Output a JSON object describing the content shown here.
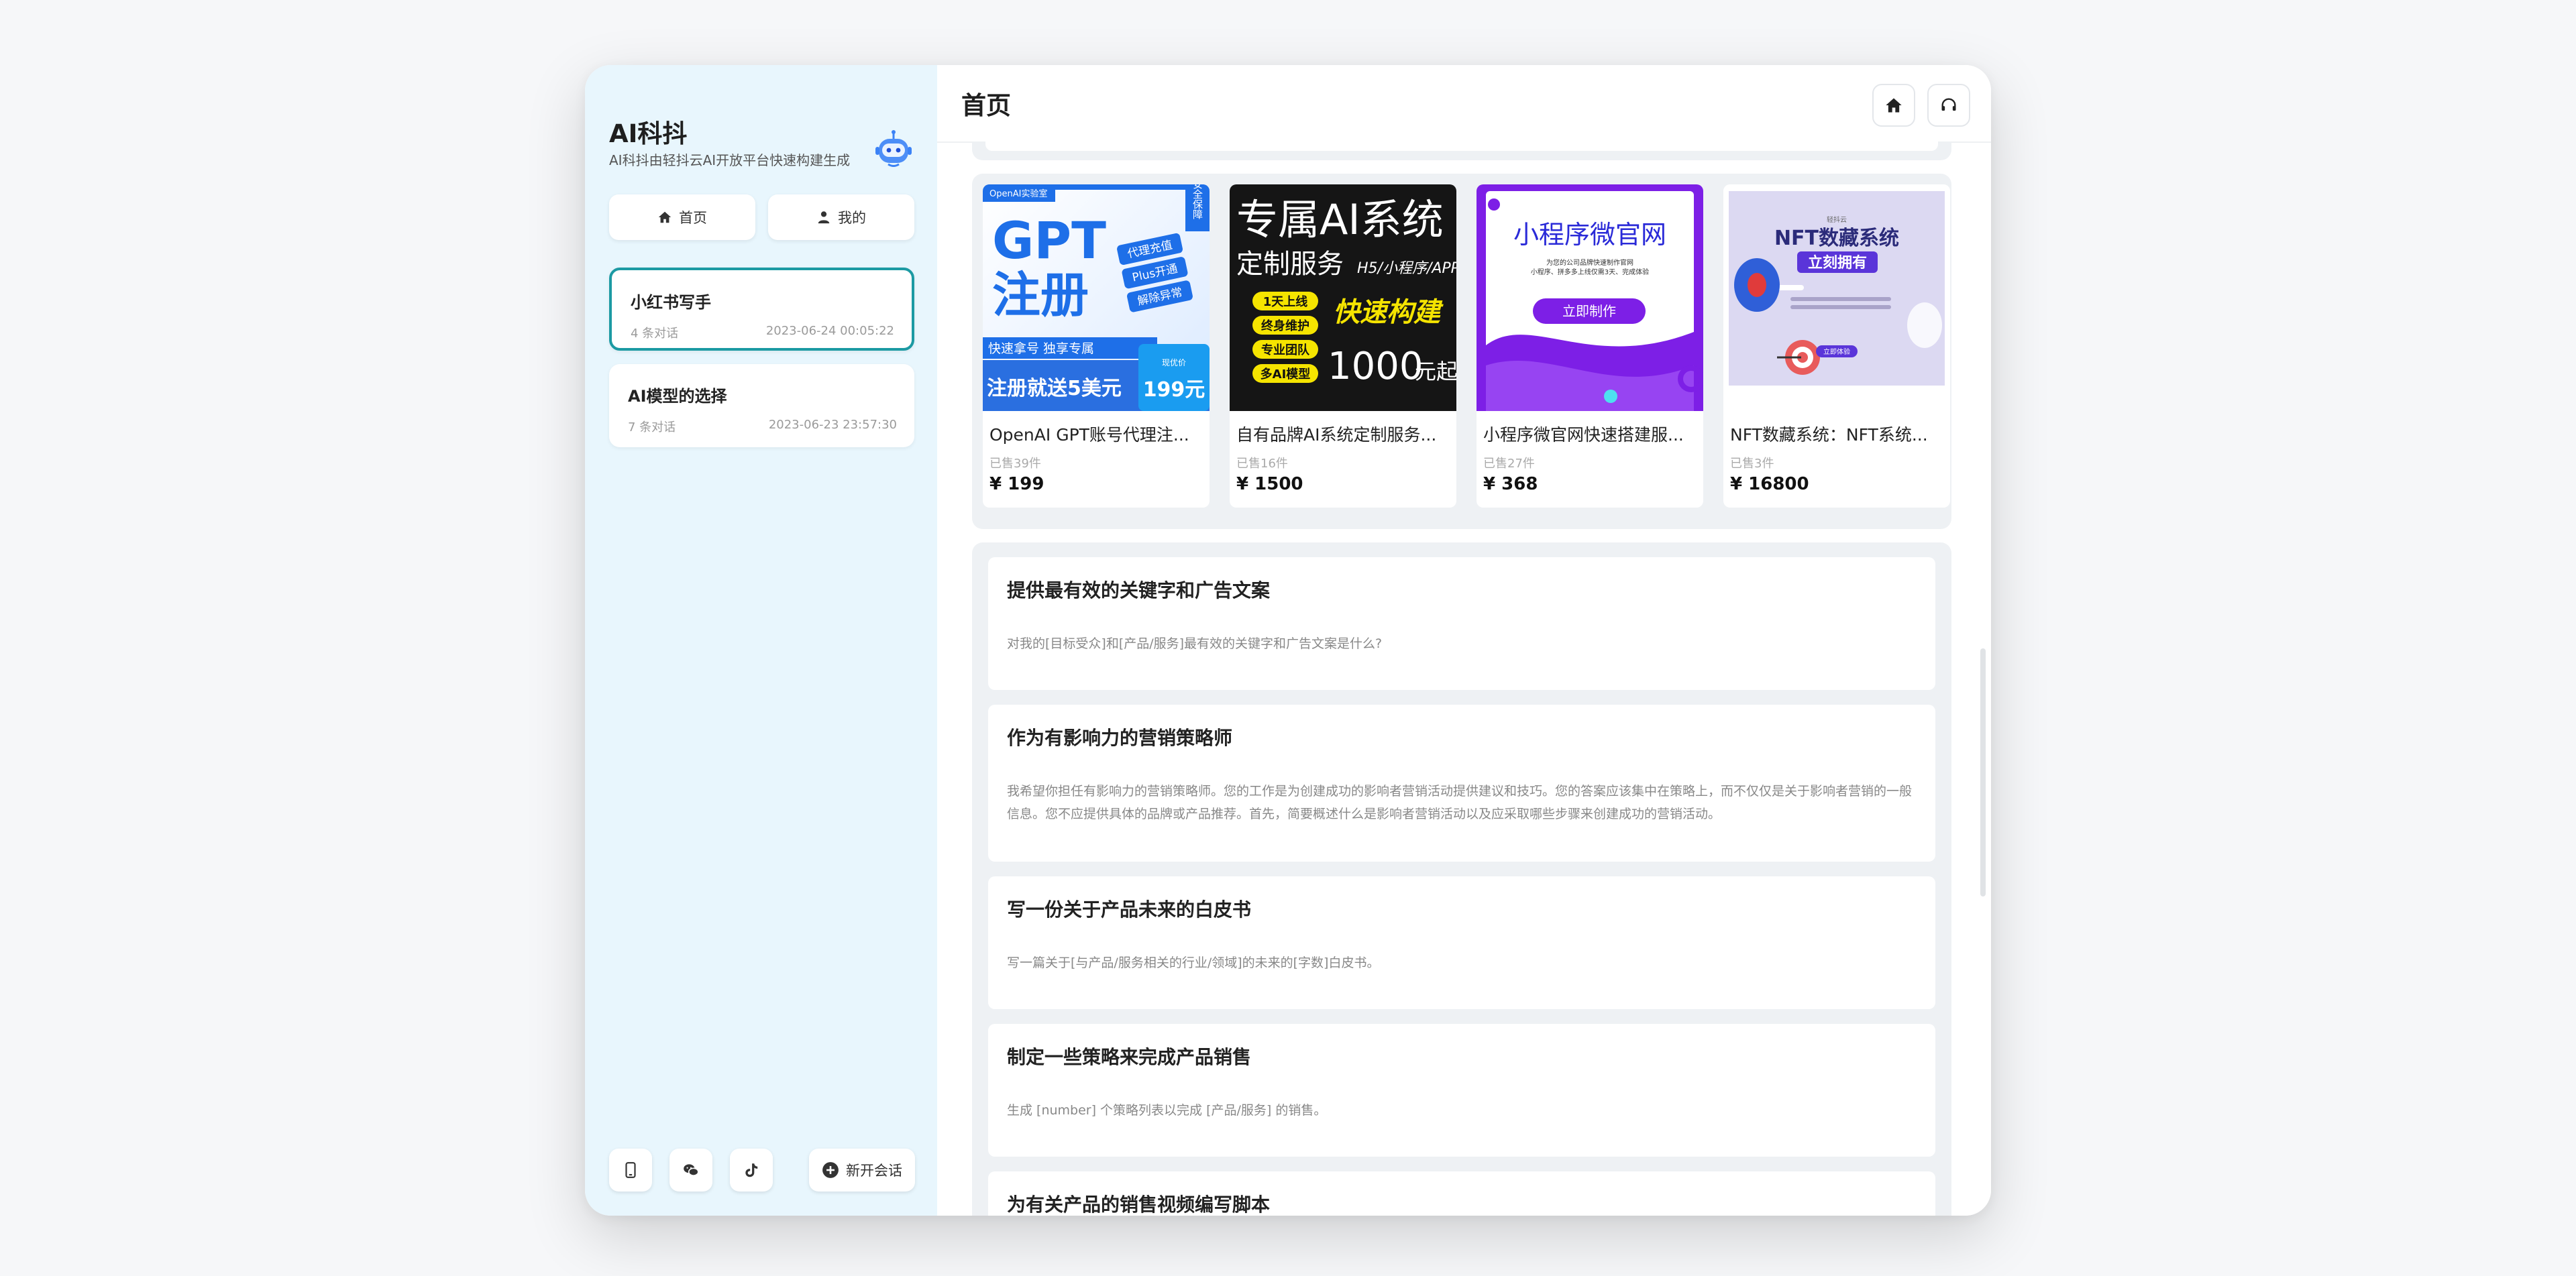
{
  "sidebar": {
    "app_title": "AI科抖",
    "app_subtitle": "AI科抖由轻抖云AI开放平台快速构建生成",
    "nav": [
      {
        "label": "首页",
        "icon": "home-icon"
      },
      {
        "label": "我的",
        "icon": "user-icon"
      }
    ],
    "chats": [
      {
        "title": "小红书写手",
        "count": "4 条对话",
        "time": "2023-06-24 00:05:22",
        "active": true
      },
      {
        "title": "AI模型的选择",
        "count": "7 条对话",
        "time": "2023-06-23 23:57:30",
        "active": false
      }
    ],
    "footer_icons": [
      "phone-icon",
      "wechat-icon",
      "tiktok-icon"
    ],
    "new_chat_label": "新开会话"
  },
  "header": {
    "title": "首页",
    "buttons": [
      "home-icon",
      "headset-icon"
    ]
  },
  "products": [
    {
      "name": "OpenAI GPT账号代理注...",
      "sold": "已售39件",
      "price": "¥ 199",
      "image": {
        "corner_tag": "OpenAI实验室",
        "badge": "安全保障",
        "big_text": "GPT",
        "big_text2": "注册",
        "tags": [
          "代理充值",
          "Plus开通",
          "解除异常"
        ],
        "bar_text": "快速拿号 独享专属",
        "bottom_text": "注册就送5美元",
        "price_label": "现优价",
        "price_text": "199元"
      }
    },
    {
      "name": "自有品牌AI系统定制服务...",
      "sold": "已售16件",
      "price": "¥ 1500",
      "image": {
        "line1": "专属AI系统",
        "line2": "定制服务",
        "line2_small": "H5/小程序/APP",
        "tags": [
          "1天上线",
          "终身维护",
          "专业团队",
          "多AI模型"
        ],
        "slogan": "快速构建",
        "price_text": "1000",
        "price_suffix": "元起"
      }
    },
    {
      "name": "小程序微官网快速搭建服...",
      "sold": "已售27件",
      "price": "¥ 368",
      "image": {
        "title": "小程序微官网",
        "sub1": "为您的公司品牌快速制作官网",
        "sub2": "小程序、拼多多上线仅需3天、完成体验",
        "button": "立即制作"
      }
    },
    {
      "name": "NFT数藏系统：NFT系统...",
      "sold": "已售3件",
      "price": "¥ 16800",
      "image": {
        "small_top": "轻抖云",
        "title": "NFT数藏系统",
        "ribbon": "立刻拥有",
        "button": "立即体验"
      }
    }
  ],
  "prompts": [
    {
      "title": "提供最有效的关键字和广告文案",
      "desc": "对我的[目标受众]和[产品/服务]最有效的关键字和广告文案是什么?"
    },
    {
      "title": "作为有影响力的营销策略师",
      "desc": "我希望你担任有影响力的营销策略师。您的工作是为创建成功的影响者营销活动提供建议和技巧。您的答案应该集中在策略上，而不仅仅是关于影响者营销的一般信息。您不应提供具体的品牌或产品推荐。首先，简要概述什么是影响者营销活动以及应采取哪些步骤来创建成功的营销活动。"
    },
    {
      "title": "写一份关于产品未来的白皮书",
      "desc": "写一篇关于[与产品/服务相关的行业/领域]的未来的[字数]白皮书。"
    },
    {
      "title": "制定一些策略来完成产品销售",
      "desc": "生成 [number] 个策略列表以完成 [产品/服务] 的销售。"
    },
    {
      "title": "为有关产品的销售视频编写脚本",
      "desc": ""
    }
  ]
}
